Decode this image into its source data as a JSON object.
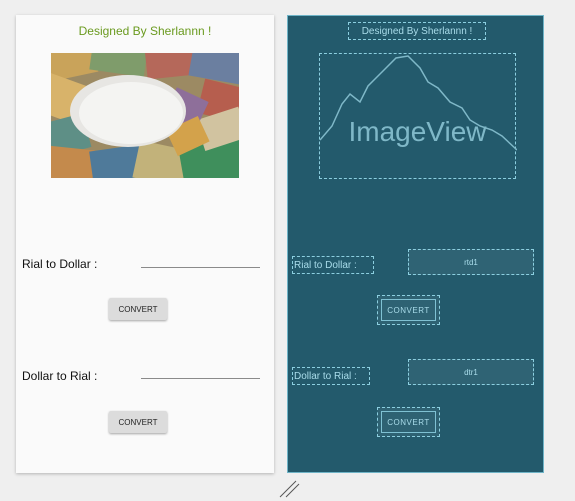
{
  "design": {
    "title": "Designed By Sherlannn !",
    "rial_to_dollar_label": "Rial to Dollar  :",
    "dollar_to_rial_label": "Dollar to Rial :",
    "convert_button_1": "CONVERT",
    "convert_button_2": "CONVERT"
  },
  "blueprint": {
    "title": "Designed By Sherlannn !",
    "image_placeholder": "ImageView",
    "rial_to_dollar_label": "Rial to Dollar  :",
    "dollar_to_rial_label": "Dollar to Rial :",
    "edit_rtd": "rtd1",
    "edit_dtr": "dtr1",
    "convert_button_1": "CONVERT",
    "convert_button_2": "CONVERT"
  },
  "colors": {
    "title_green": "#6a9a1f",
    "blueprint_bg": "#235a6c",
    "blueprint_line": "#8ccfe0"
  }
}
